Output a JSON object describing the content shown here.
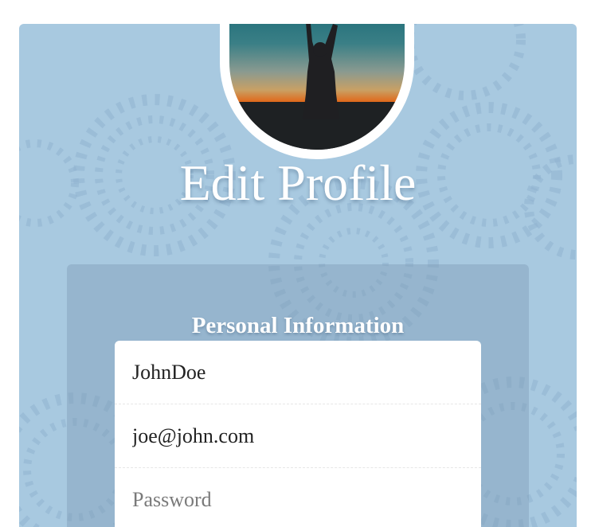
{
  "page": {
    "title": "Edit Profile",
    "section_title": "Personal Information"
  },
  "form": {
    "username": {
      "value": "JohnDoe",
      "placeholder": ""
    },
    "email": {
      "value": "joe@john.com",
      "placeholder": ""
    },
    "password": {
      "value": "",
      "placeholder": "Password"
    }
  },
  "colors": {
    "card_background": "#a8c9e0",
    "text": "#ffffff",
    "field_text": "#222222",
    "placeholder_text": "#7a7a7a"
  },
  "icons": {
    "avatar": "profile-photo-silhouette-sunset"
  }
}
